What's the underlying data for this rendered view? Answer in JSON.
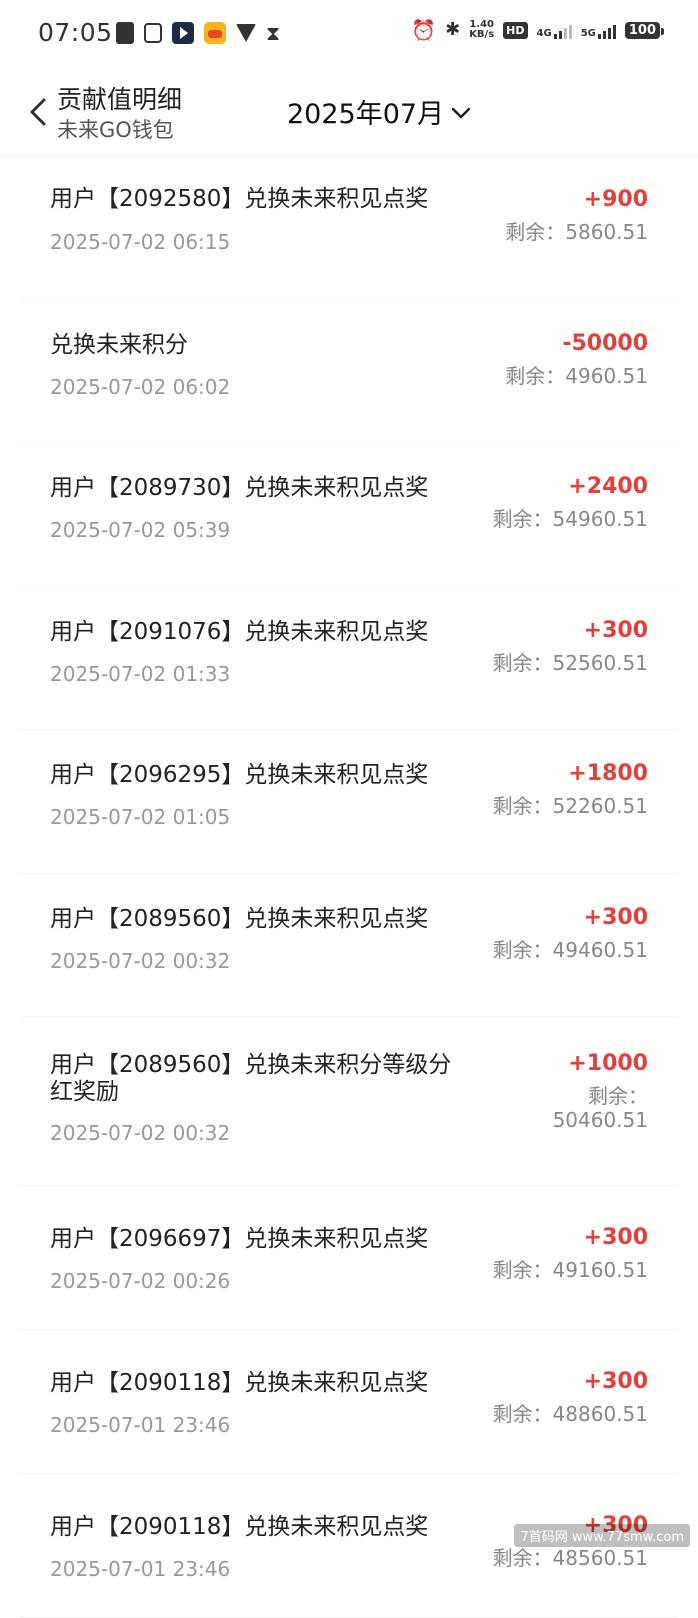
{
  "status": {
    "time": "07:05",
    "speed": "1.40",
    "speed_unit": "KB/s",
    "hd": "HD",
    "net1": "4G",
    "net2": "5G",
    "battery": "100"
  },
  "header": {
    "title": "贡献值明细",
    "subtitle": "未来GO钱包",
    "month": "2025年07月"
  },
  "items": [
    {
      "title": "用户【2092580】兑换未来积见点奖",
      "date": "2025-07-02 06:15",
      "amount": "+900",
      "balance": "剩余：5860.51"
    },
    {
      "title": "兑换未来积分",
      "date": "2025-07-02 06:02",
      "amount": "-50000",
      "balance": "剩余：4960.51"
    },
    {
      "title": "用户【2089730】兑换未来积见点奖",
      "date": "2025-07-02 05:39",
      "amount": "+2400",
      "balance": "剩余：54960.51"
    },
    {
      "title": "用户【2091076】兑换未来积见点奖",
      "date": "2025-07-02 01:33",
      "amount": "+300",
      "balance": "剩余：52560.51"
    },
    {
      "title": "用户【2096295】兑换未来积见点奖",
      "date": "2025-07-02 01:05",
      "amount": "+1800",
      "balance": "剩余：52260.51"
    },
    {
      "title": "用户【2089560】兑换未来积见点奖",
      "date": "2025-07-02 00:32",
      "amount": "+300",
      "balance": "剩余：49460.51"
    },
    {
      "title": "用户【2089560】兑换未来积分等级分",
      "title2": "红奖励",
      "date": "2025-07-02 00:32",
      "amount": "+1000",
      "balance": "剩余：",
      "balance2": "50460.51"
    },
    {
      "title": "用户【2096697】兑换未来积见点奖",
      "date": "2025-07-02 00:26",
      "amount": "+300",
      "balance": "剩余：49160.51"
    },
    {
      "title": "用户【2090118】兑换未来积见点奖",
      "date": "2025-07-01 23:46",
      "amount": "+300",
      "balance": "剩余：48860.51"
    },
    {
      "title": "用户【2090118】兑换未来积见点奖",
      "date": "2025-07-01 23:46",
      "amount": "+300",
      "balance": "剩余：48560.51"
    }
  ],
  "watermark": "7首码网 www.77smw.com"
}
